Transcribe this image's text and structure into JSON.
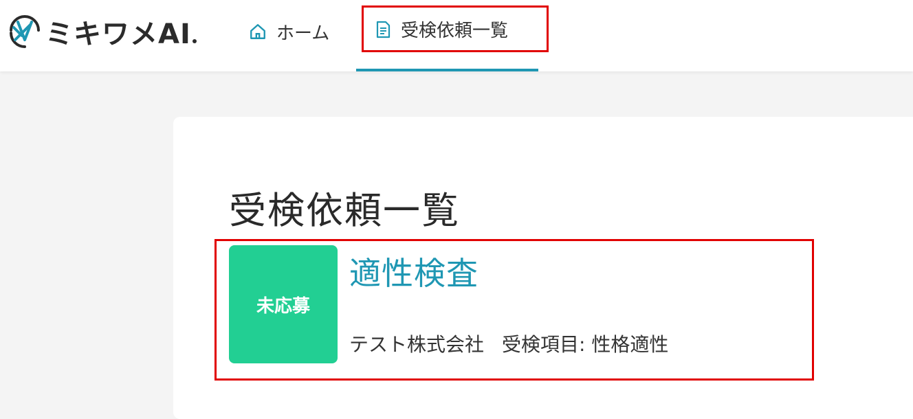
{
  "header": {
    "logo_text": "ミキワメAI",
    "nav": {
      "home_label": "ホーム",
      "requests_label": "受検依頼一覧"
    }
  },
  "main": {
    "title": "受検依頼一覧",
    "items": [
      {
        "status": "未応募",
        "title": "適性検査",
        "company": "テスト株式会社",
        "exam_items": "受検項目: 性格適性"
      }
    ]
  },
  "colors": {
    "accent": "#1f97b3",
    "status_green": "#22cf93",
    "highlight_red": "#e10000"
  }
}
